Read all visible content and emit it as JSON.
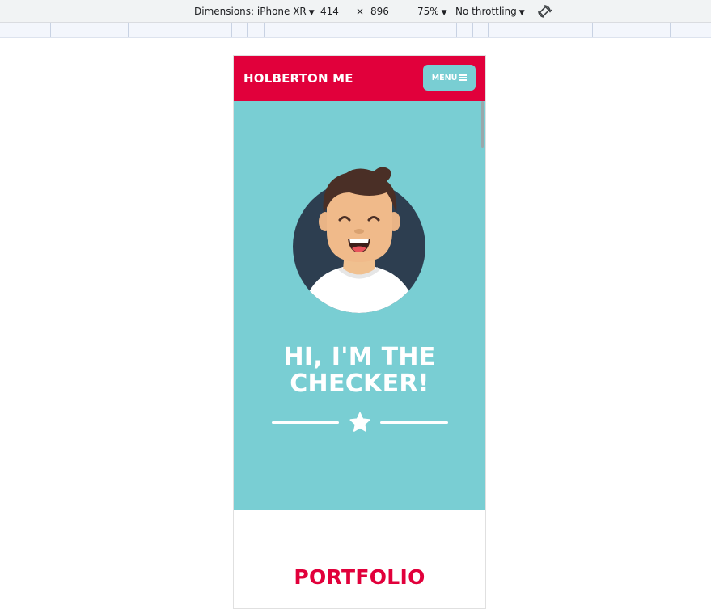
{
  "devtools": {
    "dimensions_label": "Dimensions: iPhone XR",
    "width": "414",
    "times": "×",
    "height": "896",
    "zoom": "75%",
    "throttling": "No throttling",
    "rotate_icon": "rotate-icon"
  },
  "site": {
    "brand": "HOLBERTON ME",
    "menu_label": "MENU",
    "hero_title_line1": "HI, I'M THE",
    "hero_title_line2": "CHECKER!",
    "portfolio_title": "PORTFOLIO"
  },
  "colors": {
    "header": "#e1003b",
    "hero": "#79ced3",
    "menu_button": "#79ced3",
    "avatar_bg": "#2d3e50",
    "accent_title": "#e1003b"
  },
  "icons": [
    "caret-down-icon",
    "rotate-icon",
    "hamburger-icon",
    "star-icon",
    "avatar-illustration"
  ]
}
